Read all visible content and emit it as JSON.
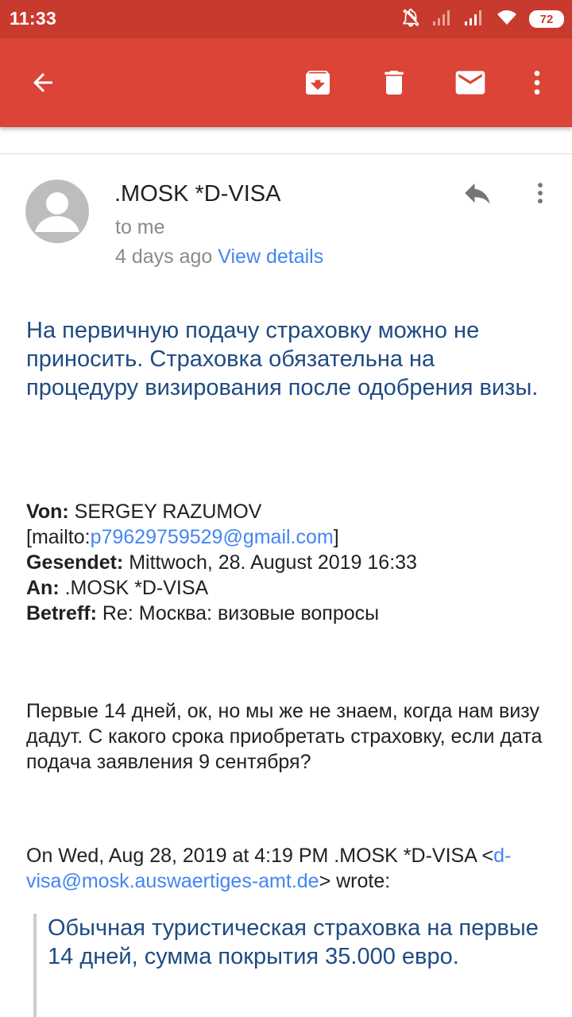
{
  "status_bar": {
    "time": "11:33",
    "battery": "72",
    "icons": [
      "bell-off-icon",
      "signal-icon",
      "signal-icon",
      "wifi-icon",
      "battery-icon"
    ]
  },
  "app_bar": {
    "icons": [
      "back-arrow-icon",
      "archive-icon",
      "delete-icon",
      "mark-unread-icon",
      "more-vert-icon"
    ],
    "color": "#db4437"
  },
  "message": {
    "sender": ".MOSK *D-VISA",
    "recipient": "to me",
    "time_ago": "4 days ago",
    "view_details": "View details",
    "intro_text": "На первичную подачу страховку можно не приносить. Страховка обязательна на процедуру визирования после одобрения визы.",
    "headers": {
      "from_label": "Von:",
      "from_name": "SERGEY RAZUMOV",
      "mailto_prefix": "[mailto:",
      "mailto_email": "p79629759529@gmail.com",
      "mailto_suffix": "]",
      "sent_label": "Gesendet:",
      "sent_value": "Mittwoch, 28. August 2019 16:33",
      "to_label": "An:",
      "to_value": ".MOSK *D-VISA",
      "subject_label": "Betreff:",
      "subject_value": "Re: Москва: визовые вопросы"
    },
    "question_text": "Первые 14 дней, ок, но мы же не знаем, когда нам визу дадут. С какого срока приобретать страховку, если дата подача заявления 9 сентября?",
    "attribution": {
      "prefix": "On Wed, Aug 28, 2019 at 4:19 PM .MOSK *D-VISA <",
      "email": "d-visa@mosk.auswaertiges-amt.de",
      "suffix": "> wrote:"
    },
    "quoted_text": "Обычная туристическая страховка на первые 14 дней, сумма покрытия 35.000 евро."
  },
  "colors": {
    "status_bar": "#c93a2e",
    "accent_link": "#4285f4",
    "quoted_text": "#1f4b83"
  }
}
